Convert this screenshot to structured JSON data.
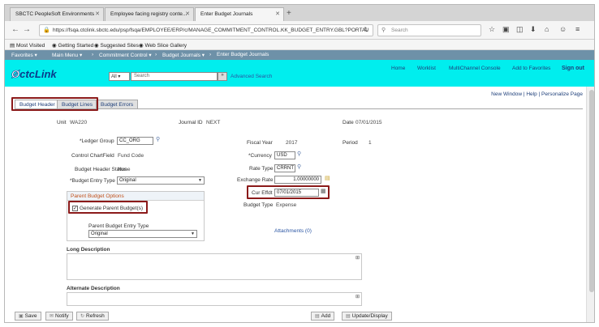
{
  "browser": {
    "tabs": [
      {
        "label": "SBCTC PeopleSoft Environments"
      },
      {
        "label": "Employee facing registry conte..."
      },
      {
        "label": "Enter Budget Journals"
      }
    ],
    "url": "https://fsqa.ctclink.sbctc.edu/psp/fsqa/EMPLOYEE/ERP/c/MANAGE_COMMITMENT_CONTROL.KK_BUDGET_ENTRY.GBL?PORTAL",
    "search_placeholder": "Search"
  },
  "bookmarks": [
    "Most Visited",
    "Getting Started",
    "Suggested Sites",
    "Web Slice Gallery"
  ],
  "menu": {
    "favorites": "Favorites",
    "main_menu": "Main Menu",
    "commitment_control": "Commitment Control",
    "budget_journals": "Budget Journals",
    "enter_budget_journals": "Enter Budget Journals"
  },
  "header": {
    "logo_prefix": "ctc",
    "logo_suffix": "Link",
    "links": [
      "Home",
      "Worklist",
      "MultiChannel Console",
      "Add to Favorites"
    ],
    "sign_out": "Sign out",
    "search_scope": "All",
    "search_placeholder": "Search",
    "go": "»",
    "advanced_search": "Advanced Search"
  },
  "page_links": "New Window | Help | Personalize Page",
  "tabs": [
    "Budget Header",
    "Budget Lines",
    "Budget Errors"
  ],
  "fields": {
    "unit_label": "Unit",
    "unit_value": "WA220",
    "journal_id_label": "Journal ID",
    "journal_id_value": "NEXT",
    "date_label": "Date",
    "date_value": "07/01/2015",
    "ledger_group_label": "*Ledger Group",
    "ledger_group_value": "CC_ORG",
    "fiscal_year_label": "Fiscal Year",
    "fiscal_year_value": "2017",
    "period_label": "Period",
    "period_value": "1",
    "control_chartfield_label": "Control ChartField",
    "control_chartfield_value": "Fund Code",
    "currency_label": "*Currency",
    "currency_value": "USD",
    "budget_header_status_label": "Budget Header Status",
    "budget_header_status_value": "None",
    "rate_type_label": "Rate Type",
    "rate_type_value": "CRRNT",
    "budget_entry_type_label": "*Budget Entry Type",
    "budget_entry_type_value": "Original",
    "exchange_rate_label": "Exchange Rate",
    "exchange_rate_value": "1.00000000",
    "cur_effdt_label": "Cur Effdt",
    "cur_effdt_value": "07/01/2015",
    "budget_type_label": "Budget Type",
    "budget_type_value": "Expense",
    "attachments": "Attachments (0)",
    "long_description_label": "Long Description",
    "alternate_description_label": "Alternate Description"
  },
  "parent_options": {
    "title": "Parent Budget Options",
    "generate_label": "Generate Parent Budget(s)",
    "generate_checked": "✓",
    "entry_type_label": "Parent Budget Entry Type",
    "entry_type_value": "Original"
  },
  "buttons": {
    "save": "Save",
    "notify": "Notify",
    "refresh": "Refresh",
    "add": "Add",
    "update_display": "Update/Display"
  }
}
